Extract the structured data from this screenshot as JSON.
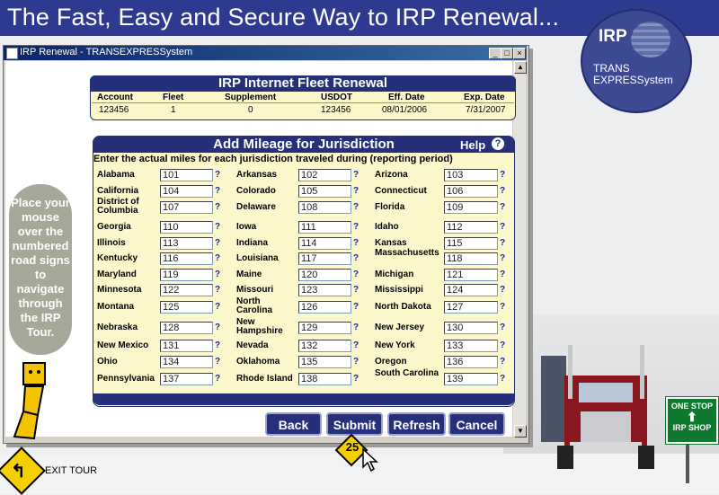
{
  "banner": {
    "title": "The Fast, Easy and Secure Way to IRP Renewal..."
  },
  "logo": {
    "irp": "IRP",
    "line1": "TRANS",
    "line2": "EXPRESSystem"
  },
  "window": {
    "title": "IRP Renewal - TRANSEXPRESSystem",
    "min": "_",
    "max": "□",
    "close": "×"
  },
  "fleet": {
    "title": "IRP Internet Fleet Renewal",
    "headers": [
      "Account",
      "Fleet",
      "Supplement",
      "USDOT",
      "Eff. Date",
      "Exp. Date"
    ],
    "values": [
      "123456",
      "1",
      "0",
      "123456",
      "08/01/2006",
      "7/31/2007"
    ]
  },
  "mileage": {
    "title": "Add Mileage for Jurisdiction",
    "help": "Help",
    "help_glyph": "?",
    "instructions": "Enter the actual miles for each jurisdiction traveled during (reporting period)",
    "q": "?",
    "rows": [
      [
        [
          "Alabama",
          "101"
        ],
        [
          "Arkansas",
          "102"
        ],
        [
          "Arizona",
          "103"
        ]
      ],
      [
        [
          "California",
          "104"
        ],
        [
          "Colorado",
          "105"
        ],
        [
          "Connecticut",
          "106"
        ]
      ],
      [
        [
          "District of Columbia",
          "107"
        ],
        [
          "Delaware",
          "108"
        ],
        [
          "Florida",
          "109"
        ]
      ],
      [
        [
          "Georgia",
          "110"
        ],
        [
          "Iowa",
          "111"
        ],
        [
          "Idaho",
          "112"
        ]
      ],
      [
        [
          "Illinois",
          "113"
        ],
        [
          "Indiana",
          "114"
        ],
        [
          "Kansas",
          "115"
        ]
      ],
      [
        [
          "Kentucky",
          "116"
        ],
        [
          "Louisiana",
          "117"
        ],
        [
          "Massachusetts",
          "118"
        ]
      ],
      [
        [
          "Maryland",
          "119"
        ],
        [
          "Maine",
          "120"
        ],
        [
          "Michigan",
          "121"
        ]
      ],
      [
        [
          "Minnesota",
          "122"
        ],
        [
          "Missouri",
          "123"
        ],
        [
          "Mississippi",
          "124"
        ]
      ],
      [
        [
          "Montana",
          "125"
        ],
        [
          "North Carolina",
          "126"
        ],
        [
          "North Dakota",
          "127"
        ]
      ],
      [
        [
          "Nebraska",
          "128"
        ],
        [
          "New Hampshire",
          "129"
        ],
        [
          "New Jersey",
          "130"
        ]
      ],
      [
        [
          "New Mexico",
          "131"
        ],
        [
          "Nevada",
          "132"
        ],
        [
          "New York",
          "133"
        ]
      ],
      [
        [
          "Ohio",
          "134"
        ],
        [
          "Oklahoma",
          "135"
        ],
        [
          "Oregon",
          "136"
        ]
      ],
      [
        [
          "Pennsylvania",
          "137"
        ],
        [
          "Rhode Island",
          "138"
        ],
        [
          "South Carolina",
          "139"
        ]
      ]
    ]
  },
  "actions": {
    "back": "Back",
    "submit": "Submit",
    "refresh": "Refresh",
    "cancel": "Cancel"
  },
  "tour": {
    "bubble": "Place your mouse over the numbered road signs to navigate through the IRP Tour.",
    "exit": "EXIT TOUR",
    "exit_arrow": "↰",
    "sign_number": "25"
  },
  "roadsign": {
    "line1": "ONE STOP",
    "arrow": "⬆",
    "line2": "IRP SHOP"
  },
  "colors": {
    "accent": "#26307a",
    "panel": "#fdf8cc",
    "banner": "#2e3a8f",
    "sign": "#f4d000",
    "stop_sign": "#0f7a2e"
  }
}
